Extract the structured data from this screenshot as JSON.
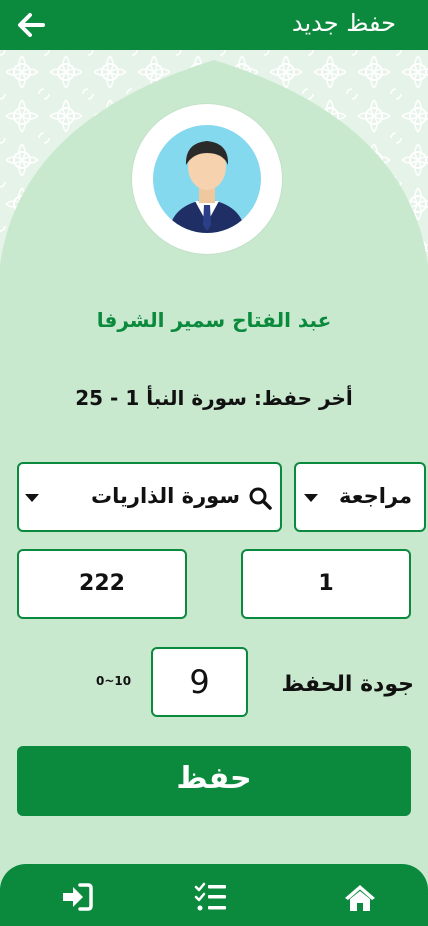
{
  "header": {
    "title": "حفظ جديد",
    "back_icon": "arrow-left-icon"
  },
  "student": {
    "name": "عبد الفتاح سمير الشرفا",
    "avatar_icon": "user-avatar-icon"
  },
  "last_memorization": "أخر حفظ: سورة النبأ  1 - 25",
  "form": {
    "type_value": "مراجعة",
    "surah_value": "سورة الذاريات",
    "from_value": "1",
    "to_value": "222",
    "quality_label": "جودة الحفظ",
    "quality_value": "9",
    "quality_range": "0~10",
    "save_label": "حفظ"
  },
  "nav": {
    "home_icon": "home-icon",
    "list_icon": "checklist-icon",
    "logout_icon": "sign-in-icon"
  },
  "colors": {
    "primary": "#0b8a3e",
    "background": "#c9e9cf"
  }
}
